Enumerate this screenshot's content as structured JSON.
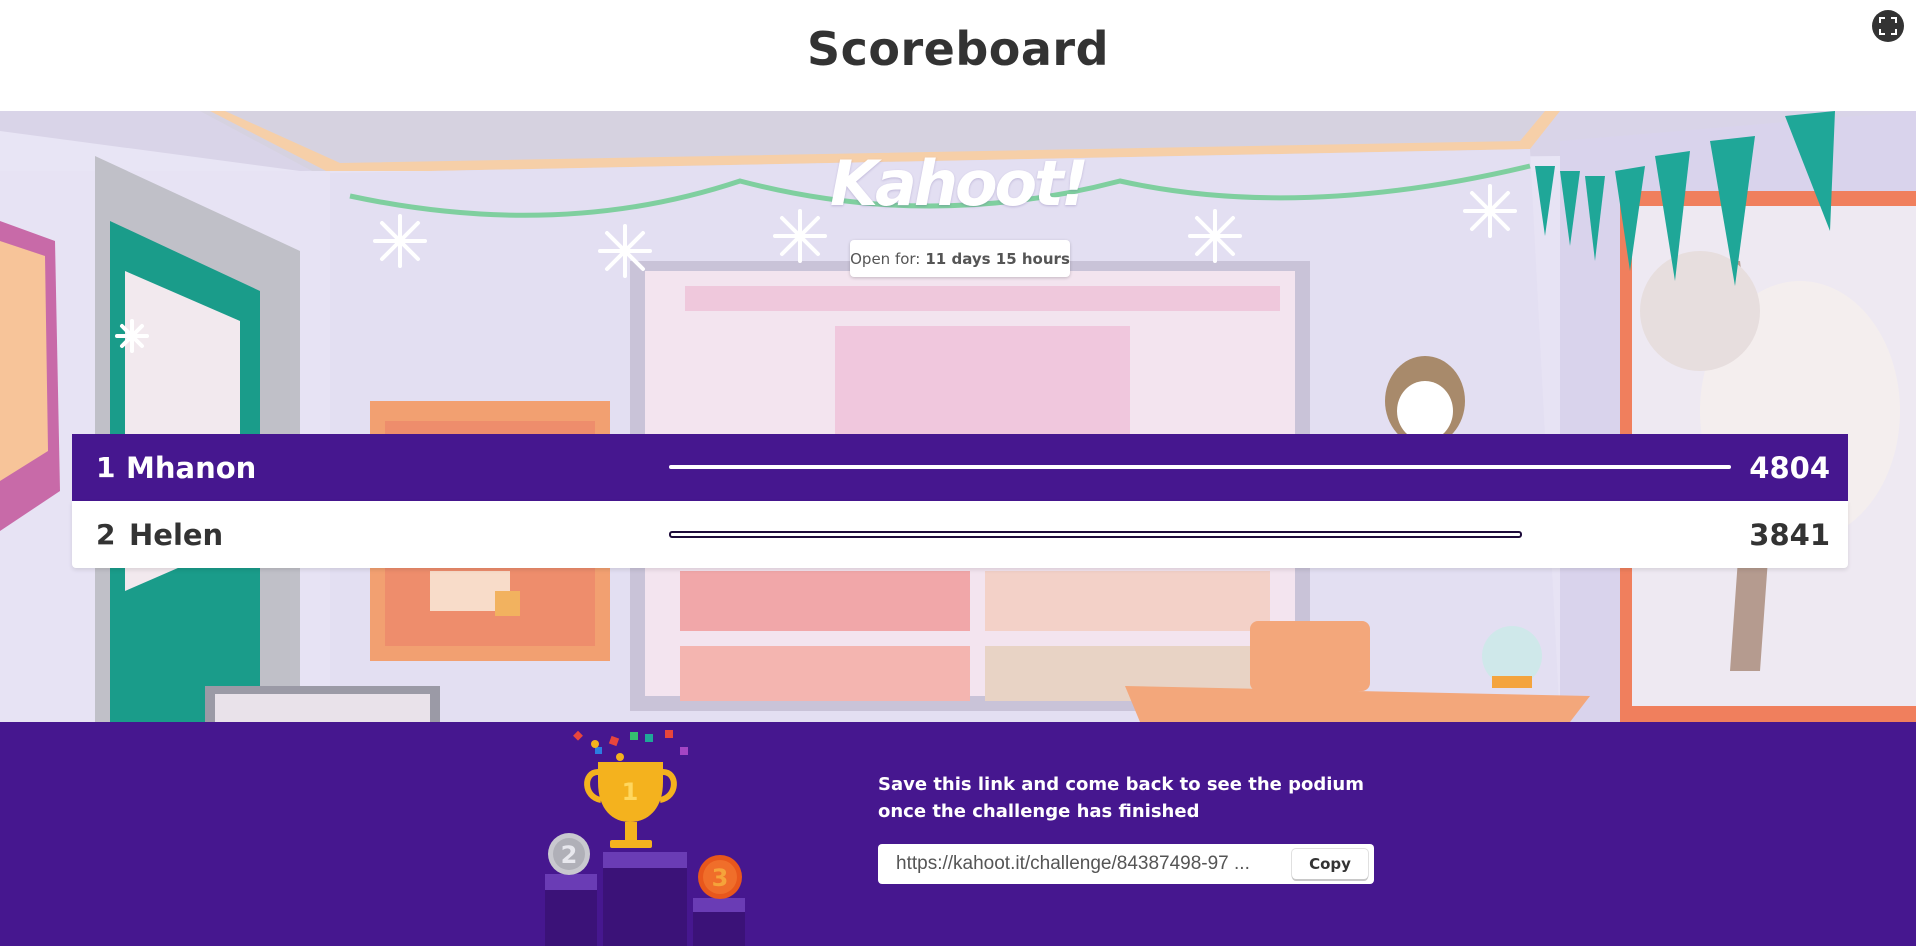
{
  "header": {
    "title": "Scoreboard",
    "fullscreen_icon": "fullscreen-icon"
  },
  "stage": {
    "logo_text": "Kahoot!",
    "open_for_label": "Open for:",
    "open_for_value": "11 days 15 hours"
  },
  "leaderboard": [
    {
      "rank": "1",
      "name": "Mhanon",
      "score": "4804",
      "score_value": 4804
    },
    {
      "rank": "2",
      "name": "Helen",
      "score": "3841",
      "score_value": 3841
    }
  ],
  "footer": {
    "message": "Save this link and come back to see the podium once the challenge has finished",
    "link_value": "https://kahoot.it/challenge/84387498-97 ...",
    "copy_label": "Copy",
    "podium_icon": "trophy-podium-icon",
    "podium_badges": [
      "2",
      "1",
      "3"
    ]
  },
  "colors": {
    "brand_purple": "#46178f",
    "text_dark": "#333333"
  }
}
